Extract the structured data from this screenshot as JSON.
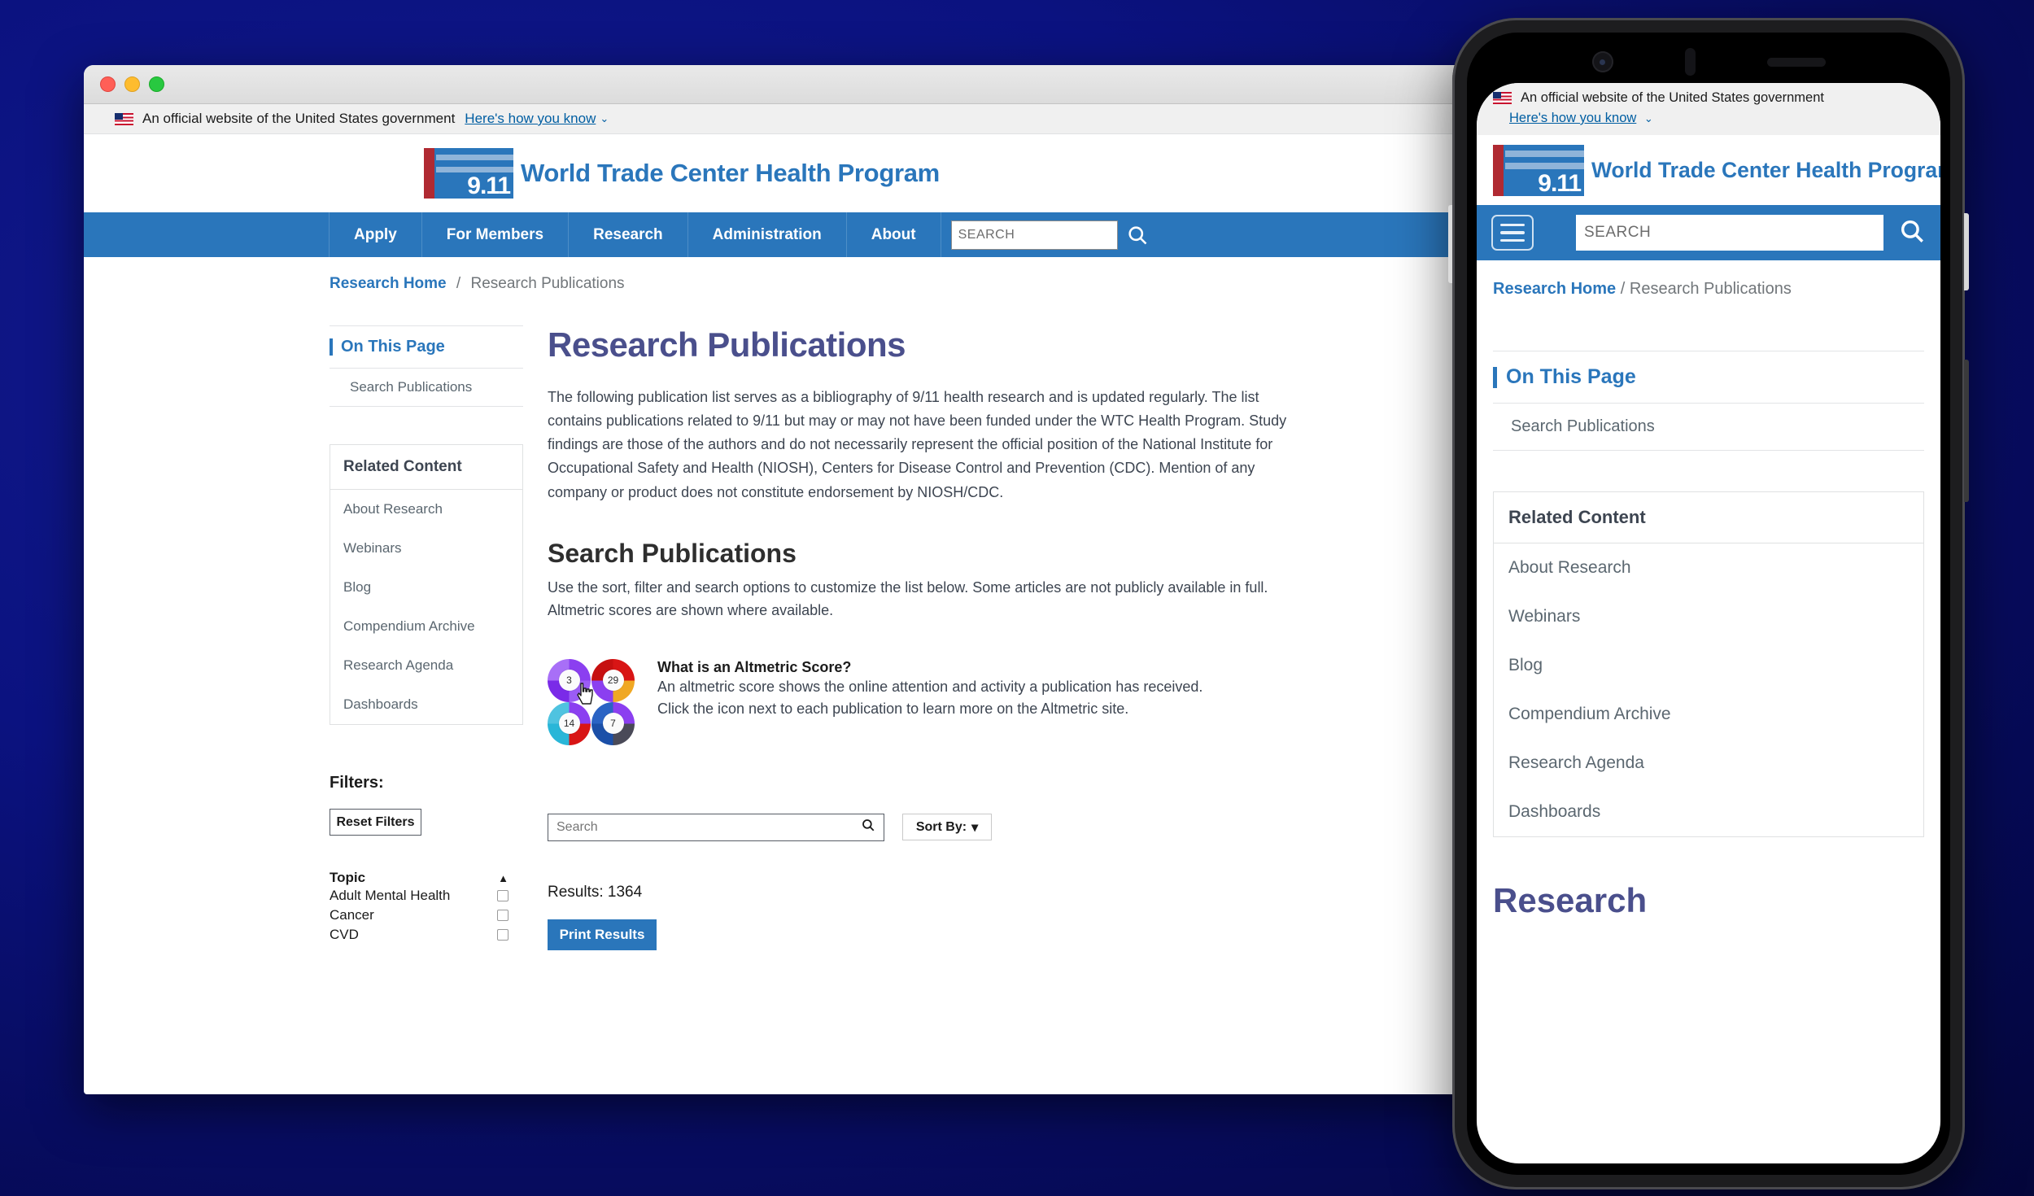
{
  "gov_banner": {
    "text": "An official website of the United States government",
    "link": "Here's how you know",
    "caret": "⌄",
    "flag_icon": "us-flag-icon"
  },
  "browser": {
    "traffic_lights": [
      "close-red",
      "minimize-yellow",
      "maximize-green"
    ]
  },
  "logo": {
    "mark_text": "9.11",
    "title": "World Trade Center Health Program"
  },
  "nav": {
    "items": [
      "Apply",
      "For Members",
      "Research",
      "Administration",
      "About"
    ],
    "search_placeholder": "SEARCH",
    "search_icon": "search-icon"
  },
  "breadcrumb": {
    "home": "Research Home",
    "separator": "/",
    "current": "Research Publications"
  },
  "on_this_page": {
    "title": "On This Page",
    "items": [
      "Search Publications"
    ]
  },
  "related_content": {
    "title": "Related Content",
    "items": [
      "About Research",
      "Webinars",
      "Blog",
      "Compendium Archive",
      "Research Agenda",
      "Dashboards"
    ]
  },
  "main": {
    "h1": "Research Publications",
    "intro": "The following publication list serves as a bibliography of 9/11 health research and is updated regularly. The list contains publications related to 9/11 but may or may not have been funded under the WTC Health Program. Study findings are those of the authors and do not necessarily represent the official position of the National Institute for Occupational Safety and Health (NIOSH), Centers for Disease Control and Prevention (CDC). Mention of any company or product does not constitute endorsement by NIOSH/CDC.",
    "h2": "Search Publications",
    "sub": "Use the sort, filter and search options to customize the list below. Some articles are not publicly available in full. Altmetric scores are shown where available.",
    "altmetric": {
      "title": "What is an Altmetric Score?",
      "line1": "An altmetric score shows the online attention and activity a publication has received.",
      "line2": "Click the icon next to each publication to learn more on the Altmetric site.",
      "donuts": [
        {
          "score": "3",
          "colors": [
            "#8b3ff0",
            "#9b5cf5",
            "#7a2be8",
            "#a86ff7"
          ]
        },
        {
          "score": "29",
          "colors": [
            "#d81515",
            "#f0a824",
            "#8b3ff0",
            "#c61010"
          ]
        },
        {
          "score": "14",
          "colors": [
            "#8b3ff0",
            "#d81515",
            "#29b6d8",
            "#4fc3e0"
          ]
        },
        {
          "score": "7",
          "colors": [
            "#8b3ff0",
            "#4a4a58",
            "#1b4fa8",
            "#2a63c4"
          ]
        }
      ]
    },
    "search_placeholder": "Search",
    "search_icon": "search-icon",
    "sort_label": "Sort By:",
    "sort_caret": "▾",
    "results": "Results: 1364",
    "print_label": "Print Results"
  },
  "filters": {
    "label": "Filters:",
    "reset_label": "Reset Filters",
    "topic_header": "Topic",
    "collapse_caret": "▲",
    "topics": [
      "Adult Mental Health",
      "Cancer",
      "CVD"
    ]
  },
  "mobile": {
    "gov_text": "An official website of the United States government",
    "gov_link": "Here's how you know",
    "menu_icon": "hamburger-menu-icon",
    "search_placeholder": "SEARCH",
    "search_icon": "search-icon",
    "h1": "Research"
  },
  "colors": {
    "brand_blue": "#2a76bb",
    "heading_purple": "#4a4f8c",
    "gov_banner_bg": "#f0f0f0",
    "background": "#0b1280"
  }
}
